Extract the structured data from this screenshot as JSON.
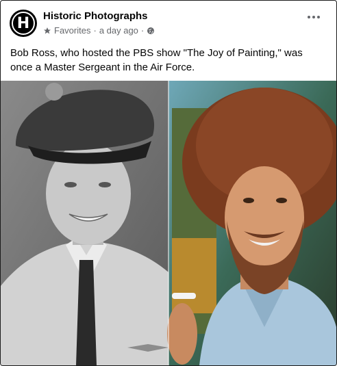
{
  "post": {
    "page_name": "Historic Photographs",
    "avatar_letter": "H",
    "audience": "Favorites",
    "timestamp": "a day ago",
    "separator": "·",
    "icons": {
      "audience": "star-icon",
      "privacy": "globe-icon",
      "menu": "more-options-icon"
    },
    "caption": "Bob Ross, who hosted the PBS show \"The Joy of Painting,\" was once a Master Sergeant in the Air Force."
  },
  "colors": {
    "meta_text": "#65676b",
    "body_text": "#050505"
  }
}
